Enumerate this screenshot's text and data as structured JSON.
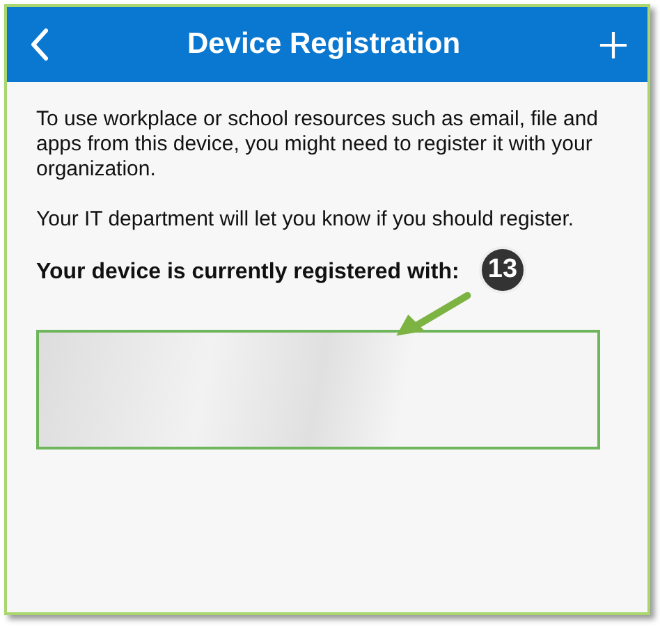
{
  "header": {
    "title": "Device Registration"
  },
  "paragraphs": [
    "To use workplace or school resources such as email, file and apps from this device, you might need to register it with your organization.",
    "Your IT department will let you know if you should register."
  ],
  "registered_heading": "Your device is currently registered with:",
  "callout": {
    "number": "13"
  }
}
